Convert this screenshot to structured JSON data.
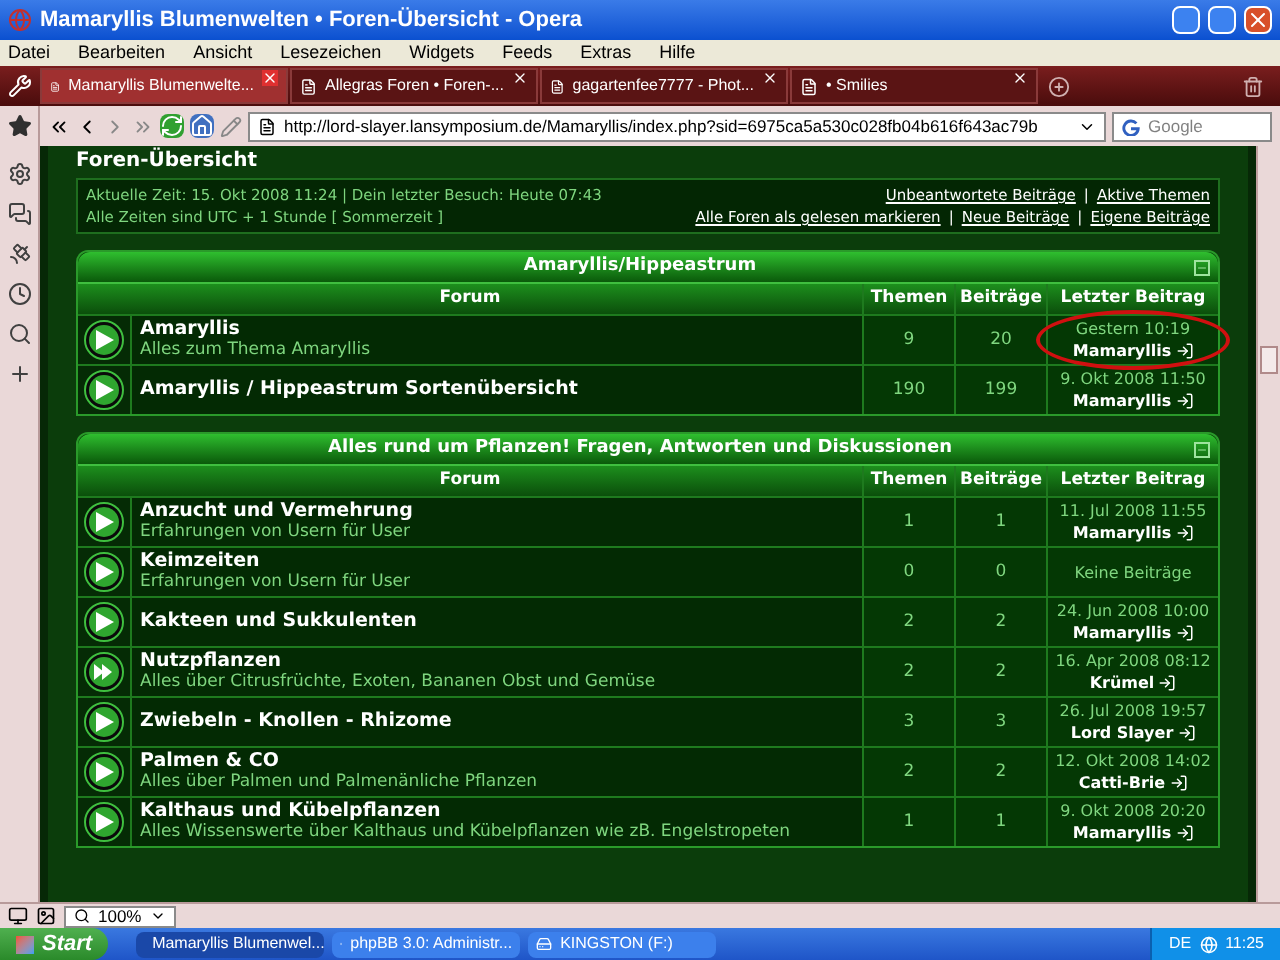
{
  "window": {
    "title": "Mamaryllis Blumenwelten • Foren-Übersicht - Opera"
  },
  "menu": [
    "Datei",
    "Bearbeiten",
    "Ansicht",
    "Lesezeichen",
    "Widgets",
    "Feeds",
    "Extras",
    "Hilfe"
  ],
  "tabs": [
    {
      "label": "Mamaryllis Blumenwelte...",
      "selected": true
    },
    {
      "label": "Allegras Foren • Foren-...",
      "selected": false
    },
    {
      "label": "gagartenfee7777 - Phot...",
      "selected": false
    },
    {
      "label": "• Smilies",
      "selected": false
    }
  ],
  "address": {
    "url": "http://lord-slayer.lansymposium.de/Mamaryllis/index.php?sid=6975ca5a530c028fb04b616f643ac79b"
  },
  "search": {
    "placeholder": "Google"
  },
  "page": {
    "heading": "Foren-Übersicht",
    "info_lines": [
      "Aktuelle Zeit: 15. Okt 2008 11:24 | Dein letzter Besuch: Heute 07:43",
      "Alle Zeiten sind UTC + 1 Stunde [ Sommerzeit ]"
    ],
    "link_separator": "|",
    "link_rows": [
      [
        "Unbeantwortete Beiträge",
        "Aktive Themen"
      ],
      [
        "Alle Foren als gelesen markieren",
        "Neue Beiträge",
        "Eigene Beiträge"
      ]
    ],
    "categories": [
      {
        "title": "Amaryllis/Hippeastrum",
        "columns": [
          "Forum",
          "Themen",
          "Beiträge",
          "Letzter Beitrag"
        ],
        "forums": [
          {
            "name": "Amaryllis",
            "description": "Alles zum Thema Amaryllis",
            "topics": "9",
            "posts": "20",
            "last_post": {
              "kind": "post",
              "date": "Gestern 10:19",
              "author": "Mamaryllis"
            },
            "new_posts": false,
            "circled": true
          },
          {
            "name": "Amaryllis / Hippeastrum Sortenübersicht",
            "topics": "190",
            "posts": "199",
            "last_post": {
              "kind": "post",
              "date": "9. Okt 2008 11:50",
              "author": "Mamaryllis"
            },
            "new_posts": false,
            "circled": false
          }
        ]
      },
      {
        "title": "Alles rund um Pflanzen! Fragen, Antworten und Diskussionen",
        "columns": [
          "Forum",
          "Themen",
          "Beiträge",
          "Letzter Beitrag"
        ],
        "forums": [
          {
            "name": "Anzucht und Vermehrung",
            "description": "Erfahrungen von Usern für User",
            "topics": "1",
            "posts": "1",
            "last_post": {
              "kind": "post",
              "date": "11. Jul 2008 11:55",
              "author": "Mamaryllis"
            },
            "new_posts": false,
            "circled": false
          },
          {
            "name": "Keimzeiten",
            "description": "Erfahrungen von Usern für User",
            "topics": "0",
            "posts": "0",
            "last_post": {
              "kind": "none",
              "text": "Keine Beiträge"
            },
            "new_posts": false,
            "circled": false
          },
          {
            "name": "Kakteen und Sukkulenten",
            "topics": "2",
            "posts": "2",
            "last_post": {
              "kind": "post",
              "date": "24. Jun 2008 10:00",
              "author": "Mamaryllis"
            },
            "new_posts": false,
            "circled": false
          },
          {
            "name": "Nutzpflanzen",
            "description": "Alles über Citrusfrüchte, Exoten, Bananen Obst und Gemüse",
            "topics": "2",
            "posts": "2",
            "last_post": {
              "kind": "post",
              "date": "16. Apr 2008 08:12",
              "author": "Krümel"
            },
            "new_posts": true,
            "circled": false
          },
          {
            "name": "Zwiebeln - Knollen - Rhizome",
            "topics": "3",
            "posts": "3",
            "last_post": {
              "kind": "post",
              "date": "26. Jul 2008 19:57",
              "author": "Lord Slayer"
            },
            "new_posts": false,
            "circled": false
          },
          {
            "name": "Palmen & CO",
            "description": "Alles über Palmen und Palmenänliche Pflanzen",
            "topics": "2",
            "posts": "2",
            "last_post": {
              "kind": "post",
              "date": "12. Okt 2008 14:02",
              "author": "Catti-Brie"
            },
            "new_posts": false,
            "circled": false
          },
          {
            "name": "Kalthaus und Kübelpflanzen",
            "description": "Alles Wissenswerte über Kalthaus und Kübelpflanzen wie zB. Engelstropeten",
            "topics": "1",
            "posts": "1",
            "last_post": {
              "kind": "post",
              "date": "9. Okt 2008 20:20",
              "author": "Mamaryllis"
            },
            "new_posts": false,
            "circled": false
          }
        ]
      }
    ]
  },
  "status_bar": {
    "zoom": "100%"
  },
  "taskbar": {
    "start": "Start",
    "tasks": [
      {
        "label": "Mamaryllis Blumenwel...",
        "selected": true
      },
      {
        "label": "phpBB 3.0: Administr...",
        "selected": false
      },
      {
        "label": "KINGSTON (F:)",
        "selected": false
      }
    ],
    "language": "DE",
    "clock": "11:25"
  }
}
